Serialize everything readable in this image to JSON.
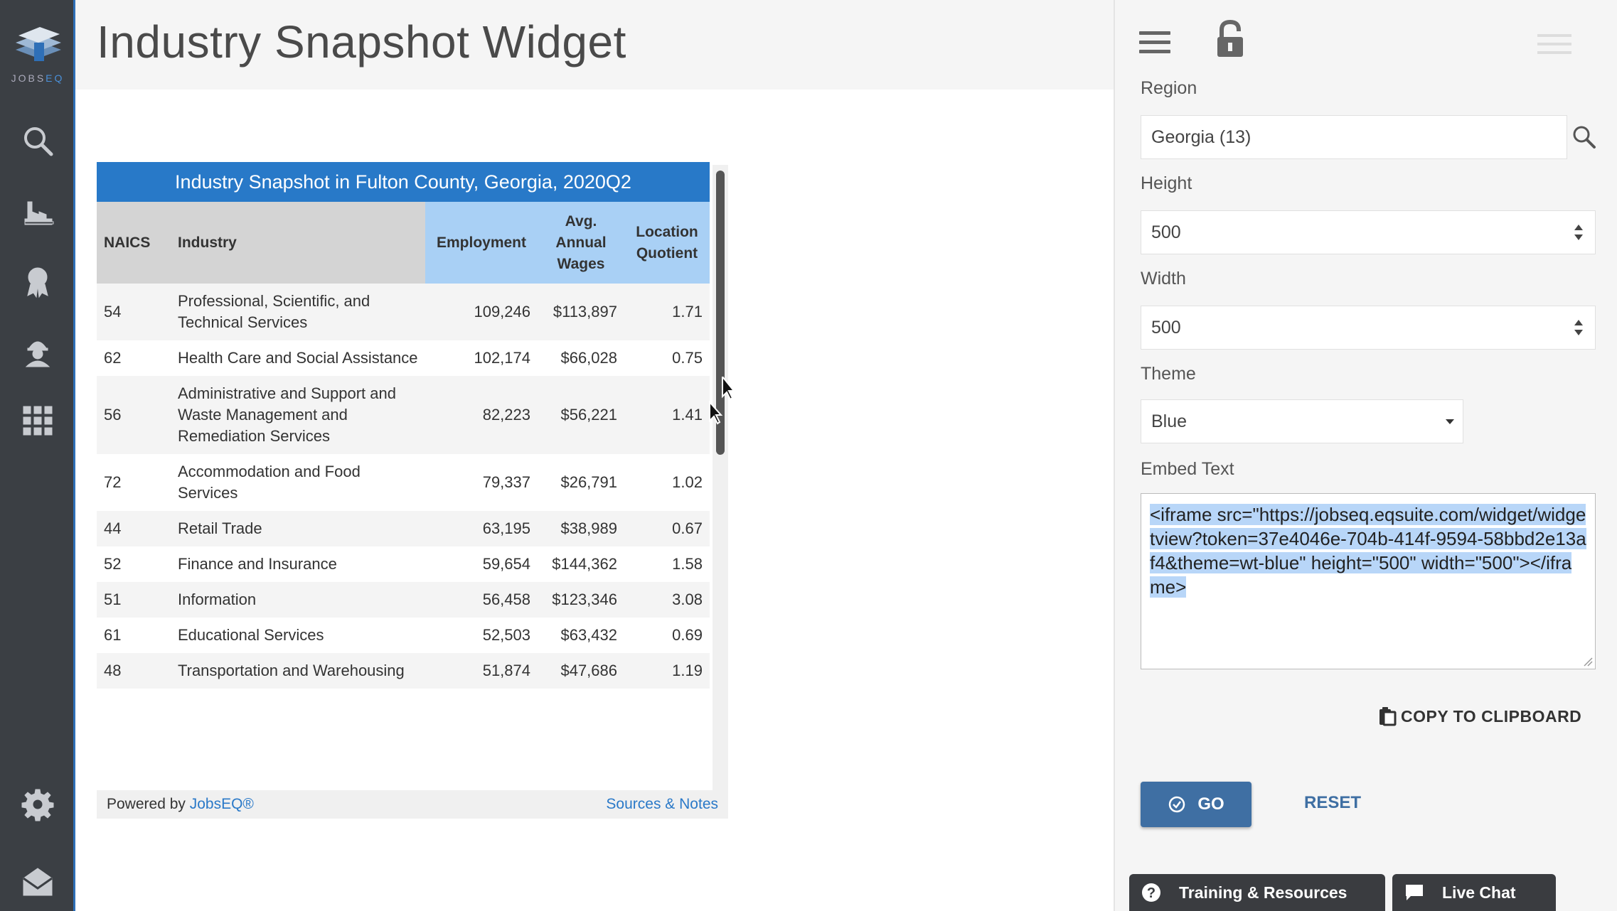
{
  "app": {
    "logo_text": "JOBS",
    "logo_text_accent": "EQ"
  },
  "header": {
    "title": "Industry Snapshot Widget"
  },
  "nav_icons": [
    "search-icon",
    "factory-icon",
    "award-icon",
    "worker-icon",
    "grid-icon",
    "gear-icon",
    "mail-icon"
  ],
  "widget": {
    "title": "Industry Snapshot in Fulton County, Georgia, 2020Q2",
    "columns": {
      "naics": "NAICS",
      "industry": "Industry",
      "employment": "Employment",
      "wages_1": "Avg.",
      "wages_2": "Annual",
      "wages_3": "Wages",
      "lq_1": "Location",
      "lq_2": "Quotient"
    },
    "rows": [
      {
        "naics": "54",
        "industry": "Professional, Scientific, and Technical Services",
        "employment": "109,246",
        "wages": "$113,897",
        "lq": "1.71"
      },
      {
        "naics": "62",
        "industry": "Health Care and Social Assistance",
        "employment": "102,174",
        "wages": "$66,028",
        "lq": "0.75"
      },
      {
        "naics": "56",
        "industry": "Administrative and Support and Waste Management and Remediation Services",
        "employment": "82,223",
        "wages": "$56,221",
        "lq": "1.41"
      },
      {
        "naics": "72",
        "industry": "Accommodation and Food Services",
        "employment": "79,337",
        "wages": "$26,791",
        "lq": "1.02"
      },
      {
        "naics": "44",
        "industry": "Retail Trade",
        "employment": "63,195",
        "wages": "$38,989",
        "lq": "0.67"
      },
      {
        "naics": "52",
        "industry": "Finance and Insurance",
        "employment": "59,654",
        "wages": "$144,362",
        "lq": "1.58"
      },
      {
        "naics": "51",
        "industry": "Information",
        "employment": "56,458",
        "wages": "$123,346",
        "lq": "3.08"
      },
      {
        "naics": "61",
        "industry": "Educational Services",
        "employment": "52,503",
        "wages": "$63,432",
        "lq": "0.69"
      },
      {
        "naics": "48",
        "industry": "Transportation and Warehousing",
        "employment": "51,874",
        "wages": "$47,686",
        "lq": "1.19"
      }
    ],
    "footer_prefix": "Powered by ",
    "footer_link": "JobsEQ®",
    "sources_link": "Sources & Notes"
  },
  "panel": {
    "region_label": "Region",
    "region_value": "Georgia (13)",
    "height_label": "Height",
    "height_value": "500",
    "width_label": "Width",
    "width_value": "500",
    "theme_label": "Theme",
    "theme_value": "Blue",
    "embed_label": "Embed Text",
    "embed_text": "<iframe src=\"https://jobseq.eqsuite.com/widget/widgetview?token=37e4046e-704b-414f-9594-58bbd2e13af4&theme=wt-blue\" height=\"500\" width=\"500\"></iframe>",
    "copy_label": "COPY TO CLIPBOARD",
    "go_label": "GO",
    "reset_label": "RESET",
    "training_label": "Training & Resources",
    "chat_label": "Live Chat"
  },
  "colors": {
    "nav_bg": "#3b3f44",
    "accent": "#2879c8",
    "header_blue": "#a9d0f5",
    "go_button": "#3f6fa3"
  }
}
